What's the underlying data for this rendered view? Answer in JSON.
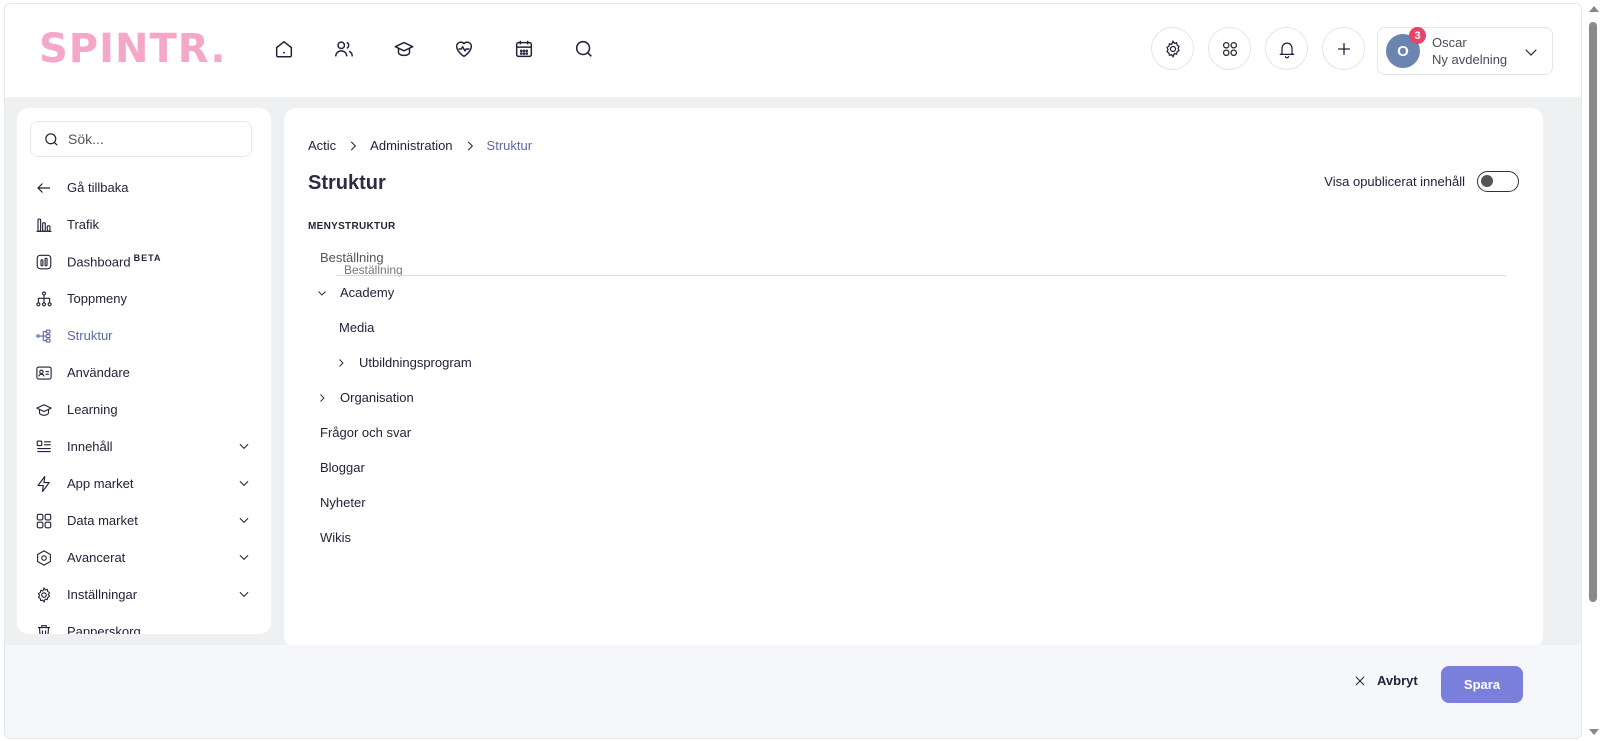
{
  "header": {
    "logo": "SPINTR.",
    "nav_icons": [
      "home-icon",
      "users-icon",
      "graduation-cap-icon",
      "heart-pulse-icon",
      "calendar-icon",
      "search-icon"
    ],
    "actions": [
      "gear-icon",
      "apps-grid-icon",
      "bell-icon",
      "plus-icon"
    ],
    "user": {
      "initial": "O",
      "badge_count": "3",
      "name": "Oscar",
      "department": "Ny avdelning"
    }
  },
  "sidebar": {
    "search_placeholder": "Sök...",
    "items": [
      {
        "label": "Gå tillbaka",
        "icon": "arrow-left-icon"
      },
      {
        "label": "Trafik",
        "icon": "bar-chart-icon"
      },
      {
        "label": "Dashboard",
        "badge": "BETA",
        "icon": "dashboard-icon"
      },
      {
        "label": "Toppmeny",
        "icon": "hierarchy-icon"
      },
      {
        "label": "Struktur",
        "icon": "structure-icon",
        "active": true
      },
      {
        "label": "Användare",
        "icon": "user-card-icon"
      },
      {
        "label": "Learning",
        "icon": "graduation-cap-icon"
      },
      {
        "label": "Innehåll",
        "icon": "content-icon",
        "expandable": true
      },
      {
        "label": "App market",
        "icon": "lightning-icon",
        "expandable": true
      },
      {
        "label": "Data market",
        "icon": "grid-icon",
        "expandable": true
      },
      {
        "label": "Avancerat",
        "icon": "hexagon-icon",
        "expandable": true
      },
      {
        "label": "Inställningar",
        "icon": "gear-icon",
        "expandable": true
      },
      {
        "label": "Papperskorg",
        "icon": "trash-icon"
      }
    ]
  },
  "main": {
    "breadcrumb": [
      "Actic",
      "Administration",
      "Struktur"
    ],
    "title": "Struktur",
    "toggle_label": "Visa opublicerat innehåll",
    "toggle_on": false,
    "section_label": "MENYSTRUKTUR",
    "drag_ghost": "Beställning",
    "tree": [
      {
        "label": "Beställning",
        "level": 0,
        "chevron": "none",
        "faded": true
      },
      {
        "label": "Academy",
        "level": 0,
        "chevron": "down"
      },
      {
        "label": "Media",
        "level": 1,
        "chevron": "none"
      },
      {
        "label": "Utbildningsprogram",
        "level": 1,
        "chevron": "right"
      },
      {
        "label": "Organisation",
        "level": 0,
        "chevron": "right"
      },
      {
        "label": "Frågor och svar",
        "level": 0,
        "chevron": "none"
      },
      {
        "label": "Bloggar",
        "level": 0,
        "chevron": "none"
      },
      {
        "label": "Nyheter",
        "level": 0,
        "chevron": "none"
      },
      {
        "label": "Wikis",
        "level": 0,
        "chevron": "none"
      }
    ]
  },
  "footer": {
    "cancel_label": "Avbryt",
    "save_label": "Spara"
  },
  "colors": {
    "logo": "#f4a7c8",
    "accent": "#5b6aa5",
    "save_button": "#7b7fdc",
    "badge": "#e6446b",
    "avatar": "#6b84b0"
  }
}
